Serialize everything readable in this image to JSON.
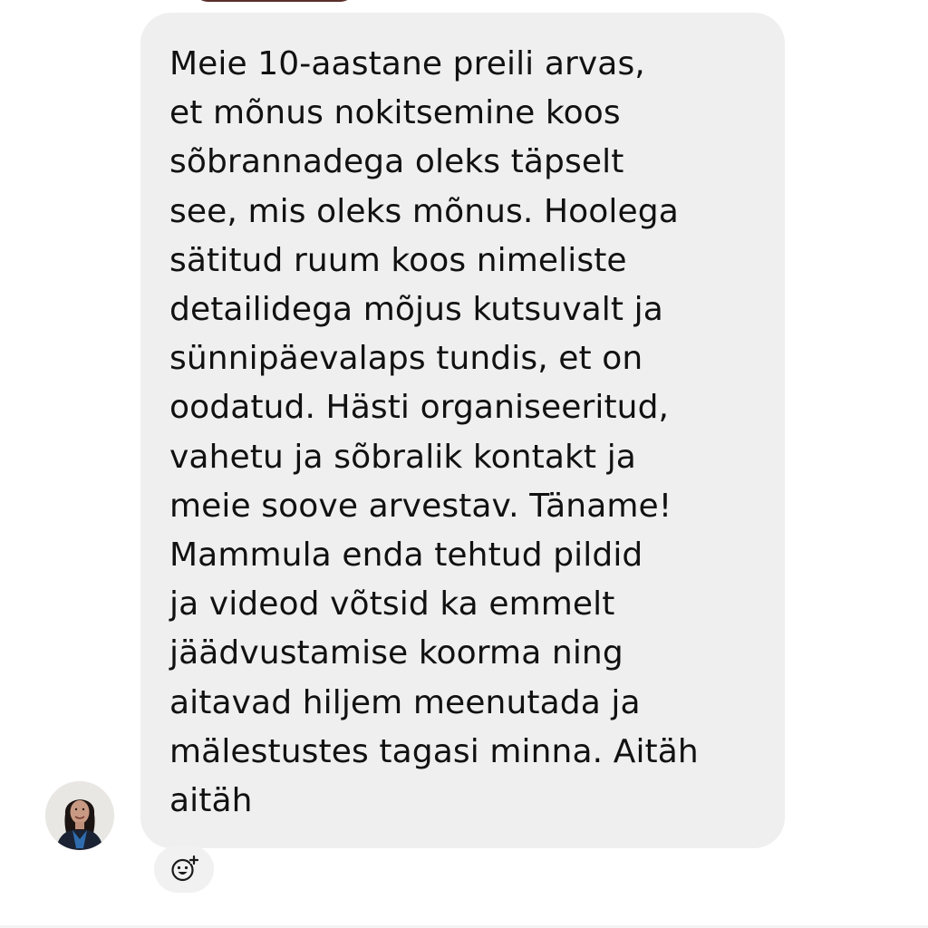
{
  "message": {
    "lines": [
      "Meie 10-aastane preili arvas,",
      "et mõnus nokitsemine koos",
      "sõbrannadega oleks täpselt",
      "see, mis oleks mõnus. Hoolega",
      "sätitud ruum koos nimeliste",
      "detailidega mõjus kutsuvalt ja",
      "sünnipäevalaps tundis, et on",
      "oodatud. Hästi organiseeritud,",
      "vahetu ja sõbralik kontakt ja",
      "meie soove arvestav. Täname!",
      "Mammula enda tehtud pildid",
      "ja videod võtsid ka emmelt",
      "jäädvustamise koorma ning",
      "aitavad hiljem meenutada ja",
      "mälestustes tagasi minna. Aitäh",
      "aitäh"
    ]
  },
  "icons": {
    "avatar": "user-avatar",
    "reaction": "add-reaction-icon"
  },
  "colors": {
    "bubble": "#efefef",
    "text": "#111111",
    "background": "#ffffff"
  }
}
